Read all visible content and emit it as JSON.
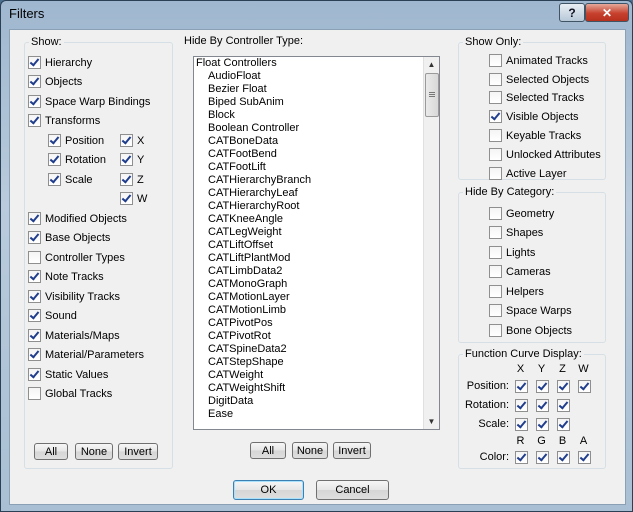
{
  "window": {
    "title": "Filters",
    "help_glyph": "?",
    "close_glyph": "✕"
  },
  "show": {
    "title": "Show:",
    "items": [
      {
        "label": "Hierarchy",
        "checked": true
      },
      {
        "label": "Objects",
        "checked": true
      },
      {
        "label": "Space Warp Bindings",
        "checked": true
      },
      {
        "label": "Transforms",
        "checked": true
      },
      {
        "label": "Position",
        "checked": true
      },
      {
        "label": "Rotation",
        "checked": true
      },
      {
        "label": "Scale",
        "checked": true
      },
      {
        "label": "X",
        "checked": true
      },
      {
        "label": "Y",
        "checked": true
      },
      {
        "label": "Z",
        "checked": true
      },
      {
        "label": "W",
        "checked": true
      },
      {
        "label": "Modified Objects",
        "checked": true
      },
      {
        "label": "Base Objects",
        "checked": true
      },
      {
        "label": "Controller Types",
        "checked": false
      },
      {
        "label": "Note Tracks",
        "checked": true
      },
      {
        "label": "Visibility Tracks",
        "checked": true
      },
      {
        "label": "Sound",
        "checked": true
      },
      {
        "label": "Materials/Maps",
        "checked": true
      },
      {
        "label": "Material/Parameters",
        "checked": true
      },
      {
        "label": "Static Values",
        "checked": true
      },
      {
        "label": "Global Tracks",
        "checked": false
      }
    ],
    "buttons": {
      "all": "All",
      "none": "None",
      "invert": "Invert"
    }
  },
  "hide_by_controller": {
    "title": "Hide By Controller Type:",
    "header": "Float Controllers",
    "items": [
      "AudioFloat",
      "Bezier Float",
      "Biped SubAnim",
      "Block",
      "Boolean Controller",
      "CATBoneData",
      "CATFootBend",
      "CATFootLift",
      "CATHierarchyBranch",
      "CATHierarchyLeaf",
      "CATHierarchyRoot",
      "CATKneeAngle",
      "CATLegWeight",
      "CATLiftOffset",
      "CATLiftPlantMod",
      "CATLimbData2",
      "CATMonoGraph",
      "CATMotionLayer",
      "CATMotionLimb",
      "CATPivotPos",
      "CATPivotRot",
      "CATSpineData2",
      "CATStepShape",
      "CATWeight",
      "CATWeightShift",
      "DigitData",
      "Ease"
    ],
    "buttons": {
      "all": "All",
      "none": "None",
      "invert": "Invert"
    }
  },
  "show_only": {
    "title": "Show Only:",
    "items": [
      {
        "label": "Animated Tracks",
        "checked": false
      },
      {
        "label": "Selected Objects",
        "checked": false
      },
      {
        "label": "Selected Tracks",
        "checked": false
      },
      {
        "label": "Visible Objects",
        "checked": true
      },
      {
        "label": "Keyable Tracks",
        "checked": false
      },
      {
        "label": "Unlocked Attributes",
        "checked": false
      },
      {
        "label": "Active Layer",
        "checked": false
      }
    ]
  },
  "hide_by_category": {
    "title": "Hide By Category:",
    "items": [
      {
        "label": "Geometry",
        "checked": false
      },
      {
        "label": "Shapes",
        "checked": false
      },
      {
        "label": "Lights",
        "checked": false
      },
      {
        "label": "Cameras",
        "checked": false
      },
      {
        "label": "Helpers",
        "checked": false
      },
      {
        "label": "Space Warps",
        "checked": false
      },
      {
        "label": "Bone Objects",
        "checked": false
      }
    ]
  },
  "function_curve": {
    "title": "Function Curve Display:",
    "xyzw": [
      "X",
      "Y",
      "Z",
      "W"
    ],
    "rgba": [
      "R",
      "G",
      "B",
      "A"
    ],
    "rows": {
      "position": "Position:",
      "rotation": "Rotation:",
      "scale": "Scale:",
      "color": "Color:"
    },
    "checked": true
  },
  "footer": {
    "ok": "OK",
    "cancel": "Cancel"
  }
}
